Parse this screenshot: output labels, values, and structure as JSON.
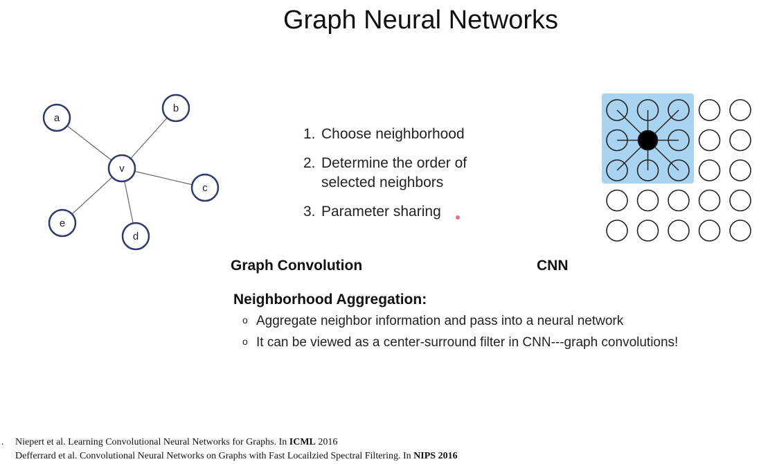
{
  "title": "Graph Neural Networks",
  "graph": {
    "center": "v",
    "neighbors": [
      "a",
      "b",
      "c",
      "d",
      "e"
    ]
  },
  "steps": [
    {
      "num": "1.",
      "line1": "Choose neighborhood",
      "line2": ""
    },
    {
      "num": "2.",
      "line1": "Determine the order of",
      "line2": "selected neighbors"
    },
    {
      "num": "3.",
      "line1": "Parameter sharing",
      "line2": ""
    }
  ],
  "captions": {
    "left": "Graph Convolution",
    "right": "CNN"
  },
  "aggregation": {
    "title": "Neighborhood Aggregation:",
    "bullet_mark": "o",
    "bullets": [
      "Aggregate neighbor information and pass into a neural network",
      "It can be viewed as a center-surround filter in CNN---graph convolutions!"
    ]
  },
  "references": [
    {
      "num": ".",
      "pre": "Niepert et al. Learning Convolutional Neural Networks for Graphs. In",
      "venue": "ICML",
      "year": "2016",
      "year_bold": false
    },
    {
      "num": "",
      "pre": "Defferrard et al. Convolutional Neural Networks on Graphs with Fast Locailzied Spectral Filtering. In",
      "venue": "NIPS",
      "year": "2016",
      "year_bold": true
    }
  ],
  "colors": {
    "node_stroke": "#2e3a6e",
    "highlight": "#a8d4f2",
    "center_fill": "#000000"
  }
}
